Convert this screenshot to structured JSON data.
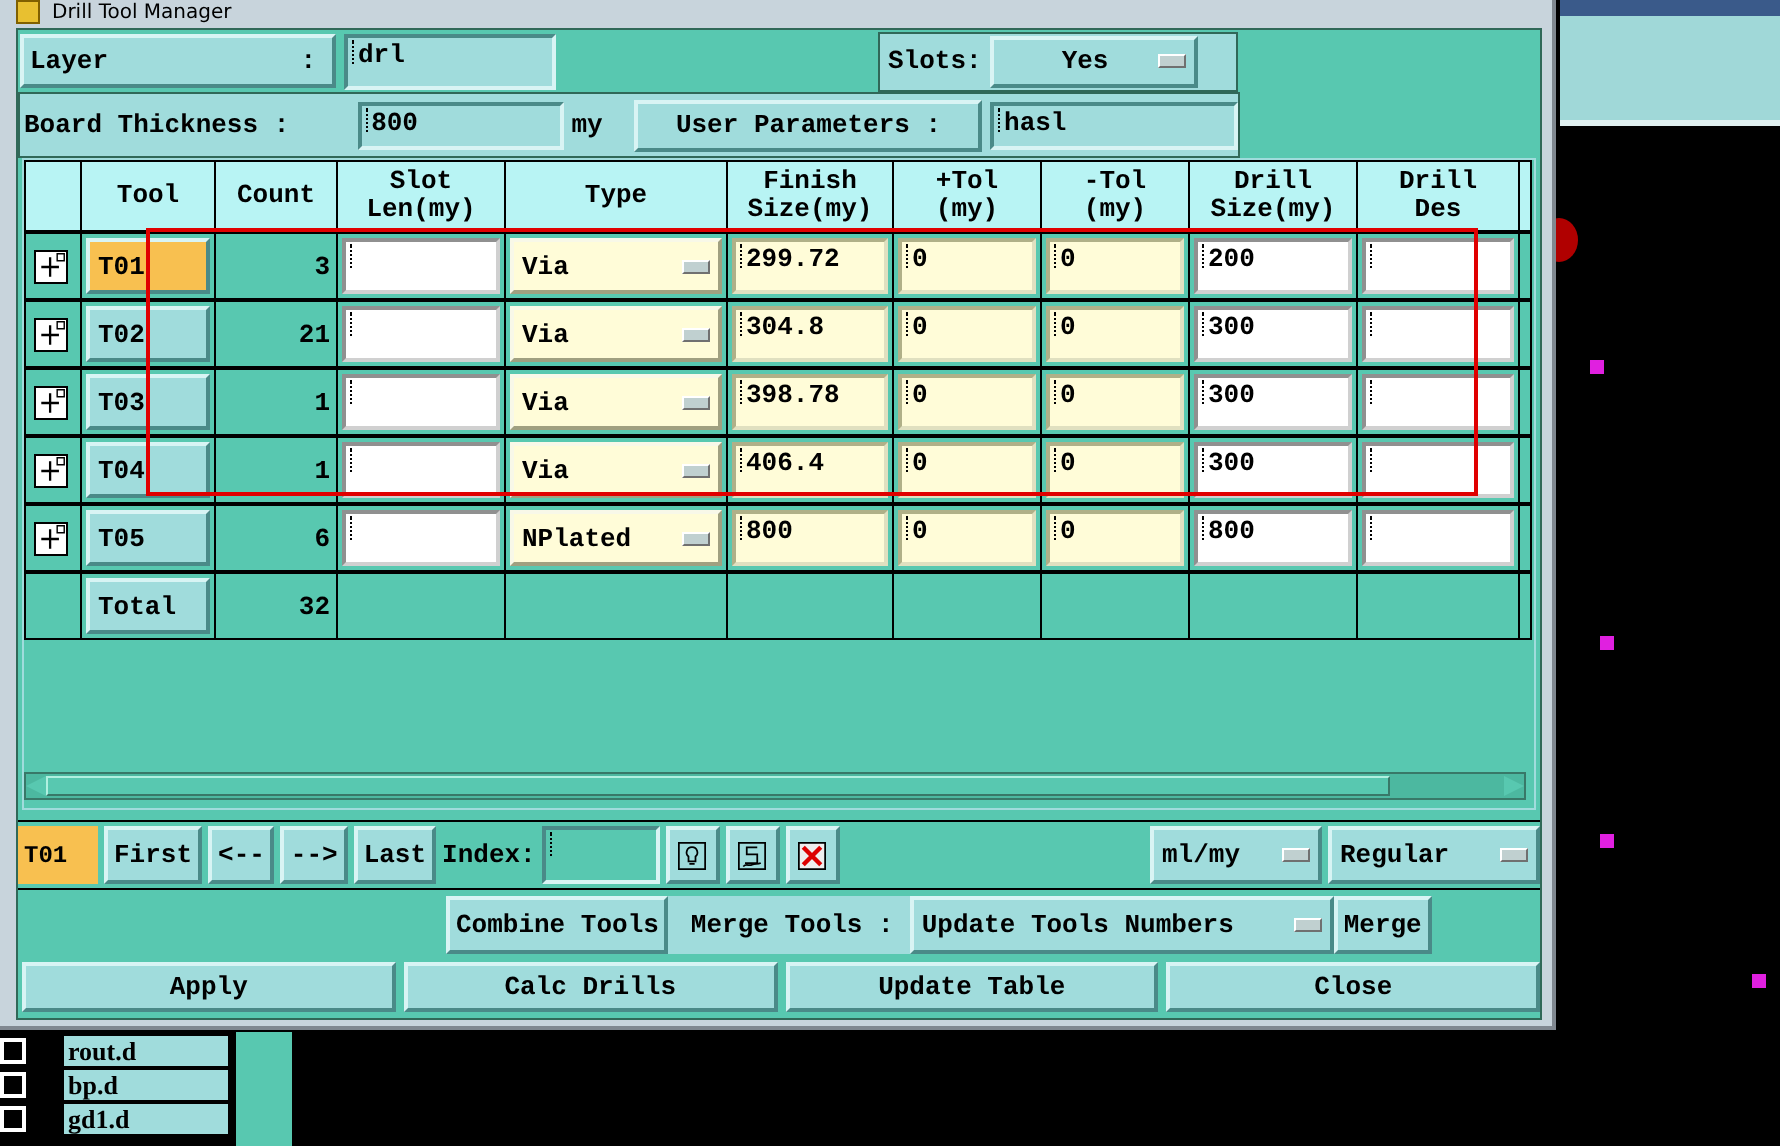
{
  "window": {
    "title": "Drill Tool Manager"
  },
  "layer": {
    "label": "Layer",
    "colon": ":",
    "value": "drl"
  },
  "slots": {
    "label": "Slots:",
    "value": "Yes"
  },
  "board_thickness": {
    "label": "Board Thickness :",
    "value": "800",
    "unit": "my"
  },
  "user_parameters": {
    "label": "User Parameters :",
    "value": "hasl"
  },
  "table": {
    "columns": [
      "Tool",
      "Count",
      "Slot\nLen(my)",
      "Type",
      "Finish\nSize(my)",
      "+Tol\n(my)",
      "-Tol\n(my)",
      "Drill\nSize(my)",
      "Drill\nDes"
    ],
    "rows": [
      {
        "tool": "T01",
        "count": "3",
        "slot_len": "",
        "type": "Via",
        "finish": "299.72",
        "plus_tol": "0",
        "minus_tol": "0",
        "drill_size": "200",
        "drill_des": "",
        "selected": true
      },
      {
        "tool": "T02",
        "count": "21",
        "slot_len": "",
        "type": "Via",
        "finish": "304.8",
        "plus_tol": "0",
        "minus_tol": "0",
        "drill_size": "300",
        "drill_des": "",
        "selected": false
      },
      {
        "tool": "T03",
        "count": "1",
        "slot_len": "",
        "type": "Via",
        "finish": "398.78",
        "plus_tol": "0",
        "minus_tol": "0",
        "drill_size": "300",
        "drill_des": "",
        "selected": false
      },
      {
        "tool": "T04",
        "count": "1",
        "slot_len": "",
        "type": "Via",
        "finish": "406.4",
        "plus_tol": "0",
        "minus_tol": "0",
        "drill_size": "300",
        "drill_des": "",
        "selected": false
      },
      {
        "tool": "T05",
        "count": "6",
        "slot_len": "",
        "type": "NPlated",
        "finish": "800",
        "plus_tol": "0",
        "minus_tol": "0",
        "drill_size": "800",
        "drill_des": "",
        "selected": false
      }
    ],
    "total": {
      "label": "Total",
      "count": "32"
    }
  },
  "navigation": {
    "current": "T01",
    "buttons": [
      "First",
      "<--",
      "-->",
      "Last"
    ],
    "index_label": "Index:",
    "units": "ml/my",
    "mode": "Regular"
  },
  "tools_row": {
    "combine": "Combine Tools",
    "merge_label": "Merge Tools :",
    "merge_option": "Update Tools Numbers",
    "merge": "Merge"
  },
  "actions": [
    "Apply",
    "Calc Drills",
    "Update Table",
    "Close"
  ],
  "layers_list": [
    {
      "name": "rout.d",
      "checked": false
    },
    {
      "name": "bp.d",
      "checked": false
    },
    {
      "name": "gd1.d",
      "checked": false
    }
  ]
}
